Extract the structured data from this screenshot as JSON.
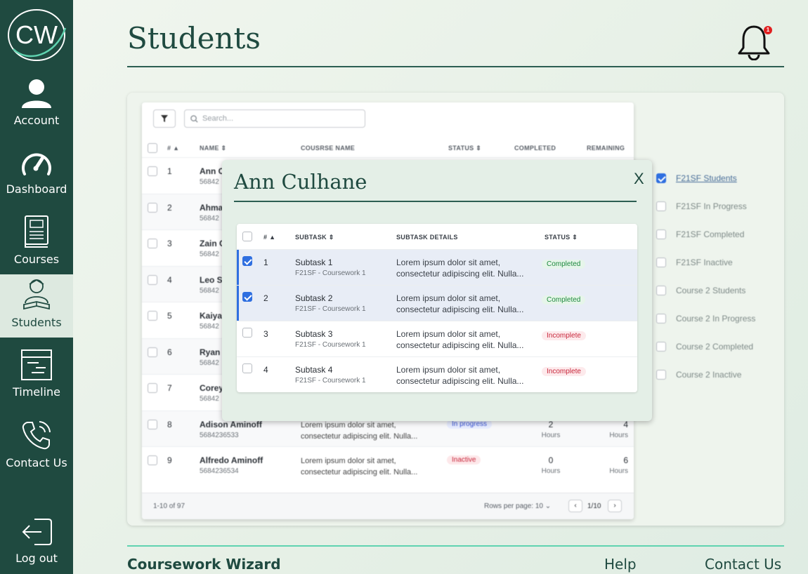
{
  "app": {
    "logo_text": "CW",
    "brand": "Coursework Wizard"
  },
  "sidebar": {
    "items": [
      {
        "label": "Account",
        "icon": "user-icon"
      },
      {
        "label": "Dashboard",
        "icon": "gauge-icon"
      },
      {
        "label": "Courses",
        "icon": "book-icon"
      },
      {
        "label": "Students",
        "icon": "student-icon",
        "active": true
      },
      {
        "label": "Timeline",
        "icon": "timeline-icon"
      },
      {
        "label": "Contact Us",
        "icon": "phone-icon"
      }
    ],
    "logout": "Log out"
  },
  "header": {
    "title": "Students",
    "notification_count": "1"
  },
  "students_table": {
    "search_placeholder": "Search...",
    "columns": {
      "num": "#",
      "name": "NAME",
      "course": "COUSRSE NAME",
      "status": "STATUS",
      "completed": "COMPLETED",
      "remaining": "REMAINING"
    },
    "rows": [
      {
        "num": "1",
        "name": "Ann C",
        "id": "56842",
        "desc1": "",
        "desc2": "",
        "status": "",
        "completed": "",
        "remaining": ""
      },
      {
        "num": "2",
        "name": "Ahma",
        "id": "56842",
        "desc1": "",
        "desc2": "",
        "status": "",
        "completed": "",
        "remaining": ""
      },
      {
        "num": "3",
        "name": "Zain C",
        "id": "56842",
        "desc1": "",
        "desc2": "",
        "status": "",
        "completed": "",
        "remaining": ""
      },
      {
        "num": "4",
        "name": "Leo S",
        "id": "56842",
        "desc1": "",
        "desc2": "",
        "status": "",
        "completed": "",
        "remaining": ""
      },
      {
        "num": "5",
        "name": "Kaiya",
        "id": "56842",
        "desc1": "",
        "desc2": "",
        "status": "",
        "completed": "",
        "remaining": ""
      },
      {
        "num": "6",
        "name": "Ryan",
        "id": "56842",
        "desc1": "",
        "desc2": "",
        "status": "",
        "completed": "",
        "remaining": ""
      },
      {
        "num": "7",
        "name": "Corey",
        "id": "56842",
        "desc1": "",
        "desc2": "",
        "status": "",
        "completed": "",
        "remaining": ""
      },
      {
        "num": "8",
        "name": "Adison Aminoff",
        "id": "5684236533",
        "desc1": "Lorem ipsum dolor sit amet,",
        "desc2": "consectetur adipiscing elit. Nulla...",
        "status": "In progress",
        "status_kind": "prog",
        "completed": "2",
        "completed_unit": "Hours",
        "remaining": "4",
        "remaining_unit": "Hours"
      },
      {
        "num": "9",
        "name": "Alfredo Aminoff",
        "id": "5684236534",
        "desc1": "Lorem ipsum dolor sit amet,",
        "desc2": "consectetur adipiscing elit. Nulla...",
        "status": "Inactive",
        "status_kind": "inact",
        "completed": "0",
        "completed_unit": "Hours",
        "remaining": "6",
        "remaining_unit": "Hours"
      }
    ],
    "footer": {
      "range": "1-10 of 97",
      "rows_per_page": "Rows per page: 10",
      "page": "1/10",
      "prev": "‹",
      "next": "›"
    }
  },
  "filters": [
    {
      "label": "F21SF Students",
      "checked": true
    },
    {
      "label": "F21SF In Progress",
      "checked": false
    },
    {
      "label": "F21SF Completed",
      "checked": false
    },
    {
      "label": "F21SF Inactive",
      "checked": false
    },
    {
      "label": "Course 2 Students",
      "checked": false
    },
    {
      "label": "Course 2 In Progress",
      "checked": false
    },
    {
      "label": "Course 2 Completed",
      "checked": false
    },
    {
      "label": "Course 2 Inactive",
      "checked": false
    }
  ],
  "modal": {
    "title": "Ann Culhane",
    "close": "X",
    "columns": {
      "num": "#",
      "subtask": "SUBTASK",
      "details": "SUBTASK DETAILS",
      "status": "STATUS"
    },
    "rows": [
      {
        "num": "1",
        "name": "Subtask 1",
        "course": "F21SF - Coursework 1",
        "desc1": "Lorem ipsum dolor sit amet,",
        "desc2": "consectetur adipiscing elit. Nulla...",
        "status": "Completed",
        "kind": "done",
        "checked": true
      },
      {
        "num": "2",
        "name": "Subtask 2",
        "course": "F21SF - Coursework 1",
        "desc1": "Lorem ipsum dolor sit amet,",
        "desc2": "consectetur adipiscing elit. Nulla...",
        "status": "Completed",
        "kind": "done",
        "checked": true
      },
      {
        "num": "3",
        "name": "Subtask 3",
        "course": "F21SF - Coursework 1",
        "desc1": "Lorem ipsum dolor sit amet,",
        "desc2": "consectetur adipiscing elit. Nulla...",
        "status": "Incomplete",
        "kind": "inc",
        "checked": false
      },
      {
        "num": "4",
        "name": "Subtask 4",
        "course": "F21SF - Coursework 1",
        "desc1": "Lorem ipsum dolor sit amet,",
        "desc2": "consectetur adipiscing elit. Nulla...",
        "status": "Incomplete",
        "kind": "inc",
        "checked": false
      }
    ]
  },
  "footer": {
    "help": "Help",
    "contact": "Contact Us"
  }
}
